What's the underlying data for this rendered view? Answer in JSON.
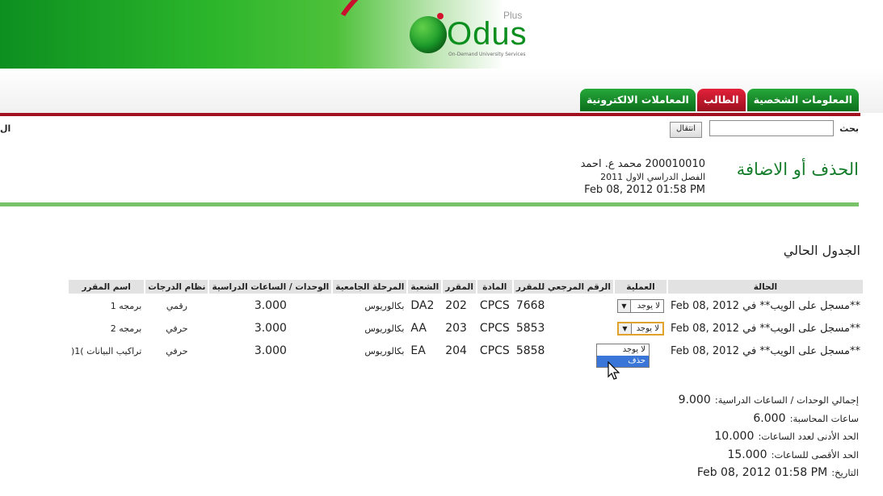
{
  "header": {
    "logo_name": "Odus",
    "logo_plus": "Plus",
    "logo_tagline": "On-Demand University Services"
  },
  "tabs": [
    {
      "label": "المعلومات الشخصية",
      "color": "green"
    },
    {
      "label": "الطالب",
      "color": "red"
    },
    {
      "label": "المعاملات الالكترونية",
      "color": "green"
    }
  ],
  "search": {
    "label": "بحث",
    "value": "",
    "go_label": "انتقال",
    "left_cut_text": "ال"
  },
  "page": {
    "title": "الحذف أو الاضافة",
    "student_line": "200010010 محمد ع. احمد",
    "term": "الفصل الدراسي الاول 2011",
    "datetime": "Feb 08, 2012 01:58 PM"
  },
  "section": {
    "title": "الجدول الحالي"
  },
  "table": {
    "headers": {
      "status": "الحالة",
      "operation": "العملية",
      "ref": "الرقم المرجعي للمقرر",
      "subject": "المادة",
      "course": "المقرر",
      "section": "الشعبة",
      "level": "المرحلة الجامعية",
      "units": "الوحدات / الساعات الدراسية",
      "grading": "نظام الدرجات",
      "name": "اسم المقرر"
    },
    "rows": [
      {
        "status": "**مسجل على الويب** في Feb 08, 2012",
        "operation": "لا يوجد",
        "ref": "7668",
        "subject": "CPCS",
        "course": "202",
        "section": "DA2",
        "level": "بكالوريوس",
        "units": "3.000",
        "grading": "رقمي",
        "name": "برمجه 1"
      },
      {
        "status": "**مسجل على الويب** في Feb 08, 2012",
        "operation": "لا يوجد",
        "ref": "5853",
        "subject": "CPCS",
        "course": "203",
        "section": "AA",
        "level": "بكالوريوس",
        "units": "3.000",
        "grading": "حرفي",
        "name": "برمجه 2"
      },
      {
        "status": "**مسجل على الويب** في Feb 08, 2012",
        "operation": "",
        "ref": "5858",
        "subject": "CPCS",
        "course": "204",
        "section": "EA",
        "level": "بكالوريوس",
        "units": "3.000",
        "grading": "حرفي",
        "name": "تراكيب البيانات )1("
      }
    ],
    "dropdown_options": [
      "لا يوجد",
      "حذف"
    ],
    "dropdown_highlighted": "حذف"
  },
  "summary": {
    "total_units_label": "إجمالي الوحدات / الساعات الدراسية:",
    "total_units": "9.000",
    "billing_hours_label": "ساعات المحاسبة:",
    "billing_hours": "6.000",
    "min_hours_label": "الحد الأدنى لعدد الساعات:",
    "min_hours": "10.000",
    "max_hours_label": "الحد الأقصى للساعات:",
    "max_hours": "15.000",
    "date_label": "التاريخ:",
    "date": "Feb 08, 2012 01:58 PM"
  },
  "colors": {
    "brand_green": "#0c8f1f",
    "brand_red": "#a1111f",
    "title_green": "#157d2b",
    "highlight_blue": "#3a76d8"
  }
}
